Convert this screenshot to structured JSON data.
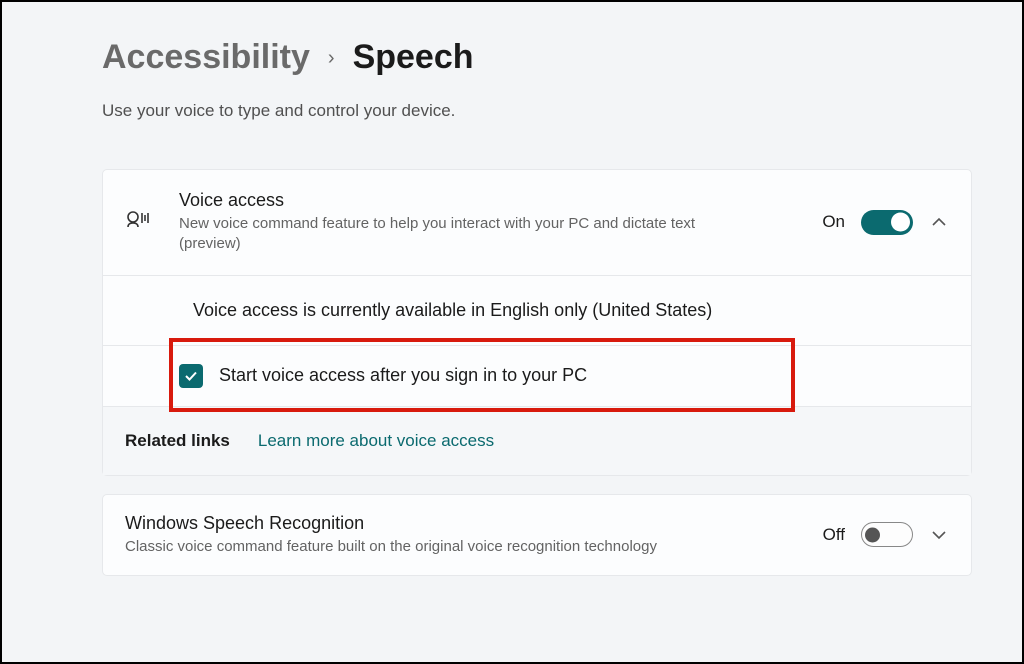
{
  "breadcrumb": {
    "parent": "Accessibility",
    "separator": "›",
    "current": "Speech"
  },
  "page_description": "Use your voice to type and control your device.",
  "voice_access": {
    "title": "Voice access",
    "subtitle": "New voice command feature to help you interact with your PC and dictate text (preview)",
    "toggle_state": "On",
    "availability_note": "Voice access is currently available in English only (United States)",
    "start_after_signin_label": "Start voice access after you sign in to your PC"
  },
  "related": {
    "label": "Related links",
    "learn_more": "Learn more about voice access"
  },
  "speech_recognition": {
    "title": "Windows Speech Recognition",
    "subtitle": "Classic voice command feature built on the original voice recognition technology",
    "toggle_state": "Off"
  }
}
